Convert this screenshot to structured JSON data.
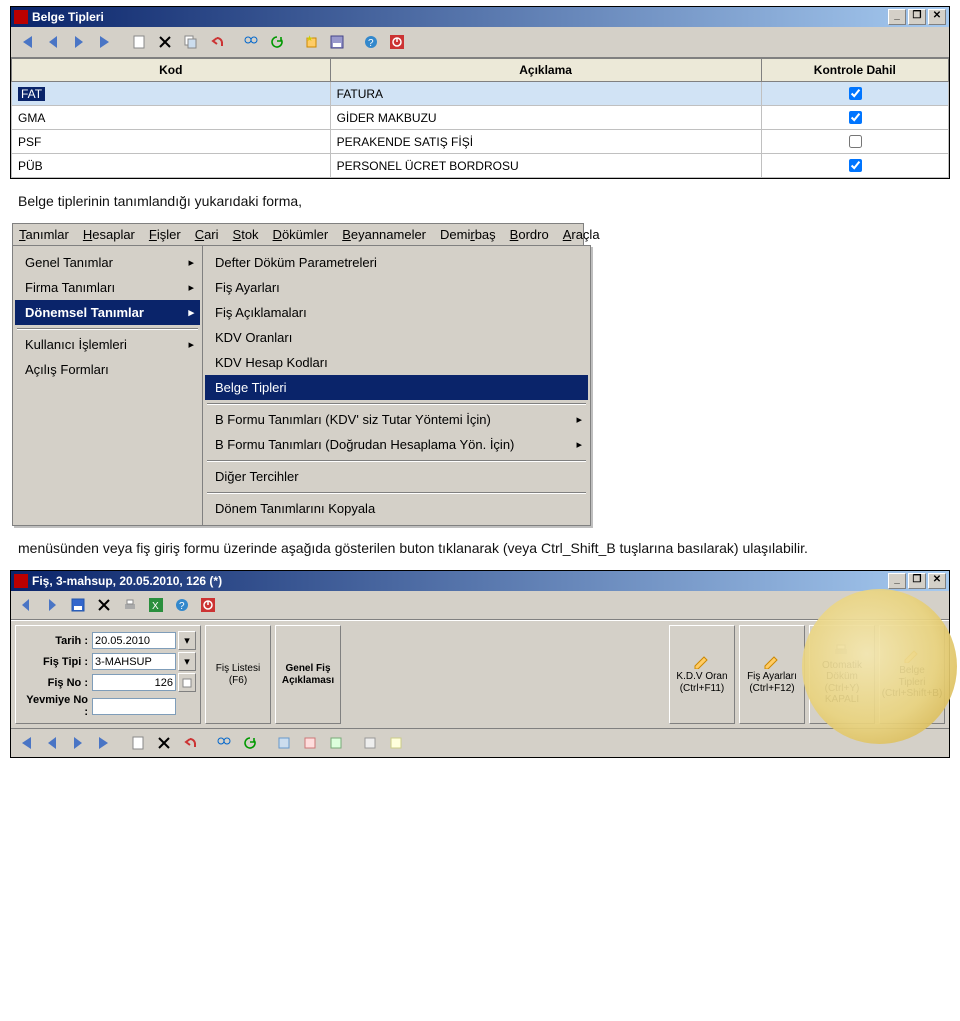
{
  "win1": {
    "title": "Belge Tipleri"
  },
  "grid": {
    "headers": {
      "kod": "Kod",
      "aciklama": "Açıklama",
      "kontrole": "Kontrole Dahil"
    },
    "rows": [
      {
        "kod": "FAT",
        "aciklama": "FATURA",
        "chk": true,
        "selected": true,
        "hl": true
      },
      {
        "kod": "GMA",
        "aciklama": "GİDER MAKBUZU",
        "chk": true,
        "selected": false
      },
      {
        "kod": "PSF",
        "aciklama": "PERAKENDE SATIŞ FİŞİ",
        "chk": false,
        "selected": false
      },
      {
        "kod": "PÜB",
        "aciklama": "PERSONEL ÜCRET BORDROSU",
        "chk": true,
        "selected": false
      }
    ]
  },
  "text1": "Belge tiplerinin tanımlandığı yukarıdaki forma,",
  "menubar": {
    "items": [
      "Tanımlar",
      "Hesaplar",
      "Fişler",
      "Cari",
      "Stok",
      "Dökümler",
      "Beyannameler",
      "Demirbaş",
      "Bordro",
      "Araçla"
    ],
    "underline_idx": [
      0,
      0,
      0,
      0,
      0,
      0,
      0,
      4,
      0,
      0
    ]
  },
  "menuLeft": [
    {
      "label": "Genel Tanımlar",
      "arrow": true
    },
    {
      "label": "Firma Tanımları",
      "arrow": true
    },
    {
      "label": "Dönemsel Tanımlar",
      "arrow": true,
      "selected": true
    },
    {
      "sep": true
    },
    {
      "label": "Kullanıcı İşlemleri",
      "arrow": true
    },
    {
      "label": "Açılış Formları"
    }
  ],
  "menuRight": [
    {
      "label": "Defter Döküm Parametreleri"
    },
    {
      "label": "Fiş Ayarları"
    },
    {
      "label": "Fiş Açıklamaları"
    },
    {
      "label": "KDV Oranları"
    },
    {
      "label": "KDV Hesap Kodları"
    },
    {
      "label": "Belge Tipleri",
      "selected": true
    },
    {
      "sep": true
    },
    {
      "label": "B Formu Tanımları (KDV' siz Tutar Yöntemi İçin)",
      "arrow": true
    },
    {
      "label": "B Formu Tanımları (Doğrudan Hesaplama Yön. İçin)",
      "arrow": true
    },
    {
      "sep": true
    },
    {
      "label": "Diğer Tercihler"
    },
    {
      "sep": true
    },
    {
      "label": "Dönem Tanımlarını Kopyala"
    }
  ],
  "text2": "menüsünden veya fiş giriş formu üzerinde aşağıda gösterilen buton tıklanarak (veya Ctrl_Shift_B tuşlarına basılarak) ulaşılabilir.",
  "win2": {
    "title": "Fiş, 3-mahsup, 20.05.2010, 126 (*)",
    "form": {
      "tarih_lbl": "Tarih :",
      "tarih_val": "20.05.2010",
      "tip_lbl": "Fiş Tipi :",
      "tip_val": "3-MAHSUP",
      "no_lbl": "Fiş No :",
      "no_val": "126",
      "yev_lbl": "Yevmiye No :",
      "yev_val": ""
    },
    "btns": {
      "fisListesi": {
        "l1": "Fiş Listesi",
        "l2": "(F6)"
      },
      "genelAck": {
        "l1": "Genel Fiş",
        "l2": "Açıklaması"
      },
      "kdv": {
        "l1": "K.D.V Oran",
        "l2": "(Ctrl+F11)"
      },
      "fisAyar": {
        "l1": "Fiş Ayarları",
        "l2": "(Ctrl+F12)"
      },
      "otoDokum": {
        "l1": "Otomatik",
        "l2": "Döküm",
        "l3": "(Ctrl+Y)",
        "l4": "KAPALI"
      },
      "belgeTip": {
        "l1": "Belge",
        "l2": "Tipleri",
        "l3": "(Ctrl+Shift+B)"
      }
    }
  }
}
